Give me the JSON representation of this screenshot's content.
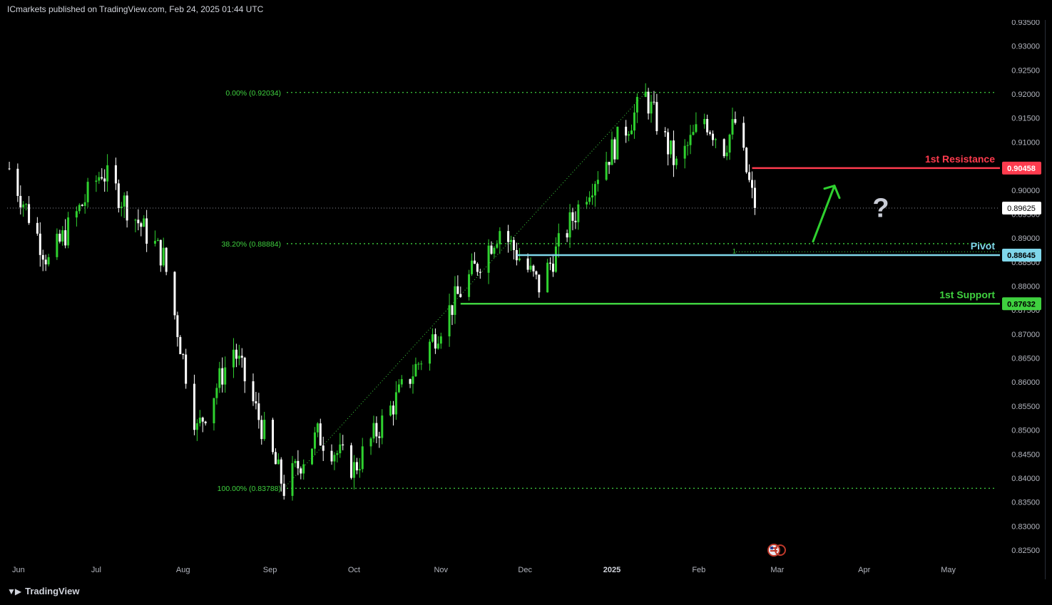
{
  "header": {
    "published": "ICmarkets published on TradingView.com, Feb 24, 2025 01:44 UTC"
  },
  "footer": {
    "brand": "TradingView",
    "logo_icon": "tradingview-logo-icon"
  },
  "colors": {
    "background": "#000000",
    "up": "#2fd12f",
    "down": "#ffffff",
    "fib": "#3fd13f",
    "resistance": "#ff3b4e",
    "pivot": "#7fd6ea",
    "support": "#3fd13f",
    "arrow": "#2fd12f",
    "question": "#c9ccd6"
  },
  "chart_data": {
    "type": "candlestick",
    "symbol_note": "daily",
    "ylim": [
      0.8225,
      0.9355
    ],
    "y_ticks": [
      "0.93500",
      "0.93000",
      "0.92500",
      "0.92000",
      "0.91500",
      "0.91000",
      "0.90500",
      "0.90000",
      "0.89500",
      "0.89000",
      "0.88500",
      "0.88000",
      "0.87500",
      "0.87000",
      "0.86500",
      "0.86000",
      "0.85500",
      "0.85000",
      "0.84500",
      "0.84000",
      "0.83500",
      "0.83000",
      "0.82500"
    ],
    "x_ticks": [
      "Jun",
      "Jul",
      "Aug",
      "Sep",
      "Oct",
      "Nov",
      "Dec",
      "2025",
      "Feb",
      "Mar",
      "Apr",
      "May"
    ],
    "fib_levels": [
      {
        "label": "0.00% (0.92034)",
        "value": 0.92034
      },
      {
        "label": "38.20% (0.88884)",
        "value": 0.88884
      },
      {
        "label": "100.00% (0.83788)",
        "value": 0.83788
      }
    ],
    "levels": [
      {
        "name": "1st Resistance",
        "value": 0.90458,
        "price_label": "0.90458",
        "color": "#ff3b4e"
      },
      {
        "name": "Pivot",
        "value": 0.88645,
        "price_label": "0.88645",
        "color": "#7fd6ea"
      },
      {
        "name": "1st Support",
        "value": 0.87632,
        "price_label": "0.87632",
        "color": "#3fd13f"
      }
    ],
    "current_price": {
      "value": 0.89625,
      "label": "0.89625"
    },
    "pivot_marker": "1",
    "annotation": {
      "question": "?",
      "arrow": "up"
    },
    "anchors": [
      {
        "date": "2024-05-31",
        "close": 0.9045
      },
      {
        "date": "2024-06-14",
        "close": 0.885
      },
      {
        "date": "2024-07-03",
        "close": 0.904
      },
      {
        "date": "2024-07-25",
        "close": 0.886
      },
      {
        "date": "2024-08-06",
        "close": 0.85
      },
      {
        "date": "2024-08-19",
        "close": 0.867
      },
      {
        "date": "2024-09-06",
        "close": 0.8379
      },
      {
        "date": "2024-09-18",
        "close": 0.849
      },
      {
        "date": "2024-10-01",
        "close": 0.842
      },
      {
        "date": "2024-10-25",
        "close": 0.865
      },
      {
        "date": "2024-11-06",
        "close": 0.877
      },
      {
        "date": "2024-11-22",
        "close": 0.892
      },
      {
        "date": "2024-12-06",
        "close": 0.88
      },
      {
        "date": "2024-12-23",
        "close": 0.9
      },
      {
        "date": "2025-01-13",
        "close": 0.9195
      },
      {
        "date": "2025-01-24",
        "close": 0.905
      },
      {
        "date": "2025-02-03",
        "close": 0.915
      },
      {
        "date": "2025-02-10",
        "close": 0.909
      },
      {
        "date": "2025-02-14",
        "close": 0.914
      },
      {
        "date": "2025-02-21",
        "close": 0.8962
      }
    ]
  }
}
